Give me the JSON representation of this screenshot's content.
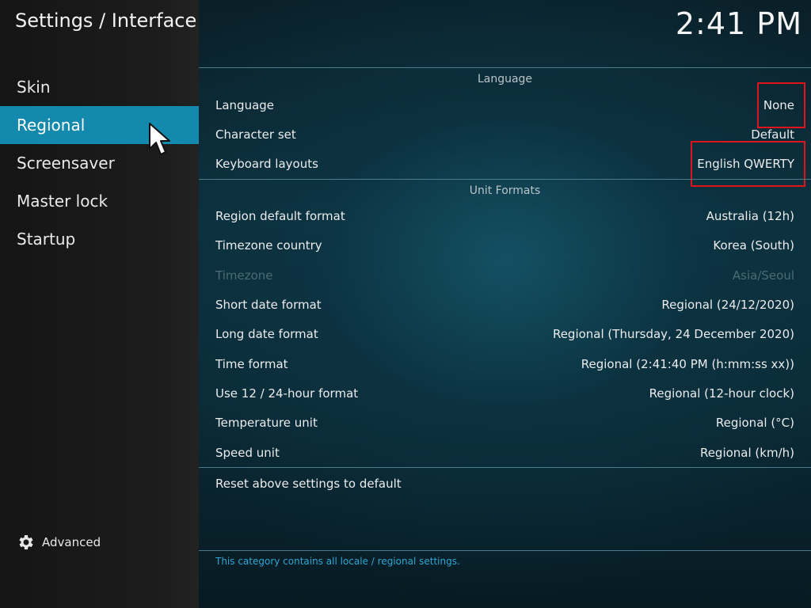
{
  "header": {
    "title": "Settings / Interface",
    "clock": "2:41 PM"
  },
  "sidebar": {
    "items": [
      {
        "label": "Skin"
      },
      {
        "label": "Regional"
      },
      {
        "label": "Screensaver"
      },
      {
        "label": "Master lock"
      },
      {
        "label": "Startup"
      }
    ],
    "advanced_label": "Advanced",
    "advanced_icon": "gear-icon"
  },
  "sections": {
    "language": {
      "title": "Language",
      "rows": [
        {
          "label": "Language",
          "value": "None"
        },
        {
          "label": "Character set",
          "value": "Default"
        },
        {
          "label": "Keyboard layouts",
          "value": "English QWERTY"
        }
      ]
    },
    "unit_formats": {
      "title": "Unit Formats",
      "rows": [
        {
          "label": "Region default format",
          "value": "Australia (12h)"
        },
        {
          "label": "Timezone country",
          "value": "Korea (South)"
        },
        {
          "label": "Timezone",
          "value": "Asia/Seoul"
        },
        {
          "label": "Short date format",
          "value": "Regional (24/12/2020)"
        },
        {
          "label": "Long date format",
          "value": "Regional (Thursday, 24 December 2020)"
        },
        {
          "label": "Time format",
          "value": "Regional (2:41:40 PM (h:mm:ss xx))"
        },
        {
          "label": "Use 12 / 24-hour format",
          "value": "Regional (12-hour clock)"
        },
        {
          "label": "Temperature unit",
          "value": "Regional (°C)"
        },
        {
          "label": "Speed unit",
          "value": "Regional (km/h)"
        }
      ]
    },
    "reset_label": "Reset above settings to default"
  },
  "footer": {
    "description": "This category contains all locale / regional settings."
  },
  "colors": {
    "accent": "#1289ad",
    "highlight_box": "#e0141a",
    "description_text": "#2fa6d3"
  }
}
